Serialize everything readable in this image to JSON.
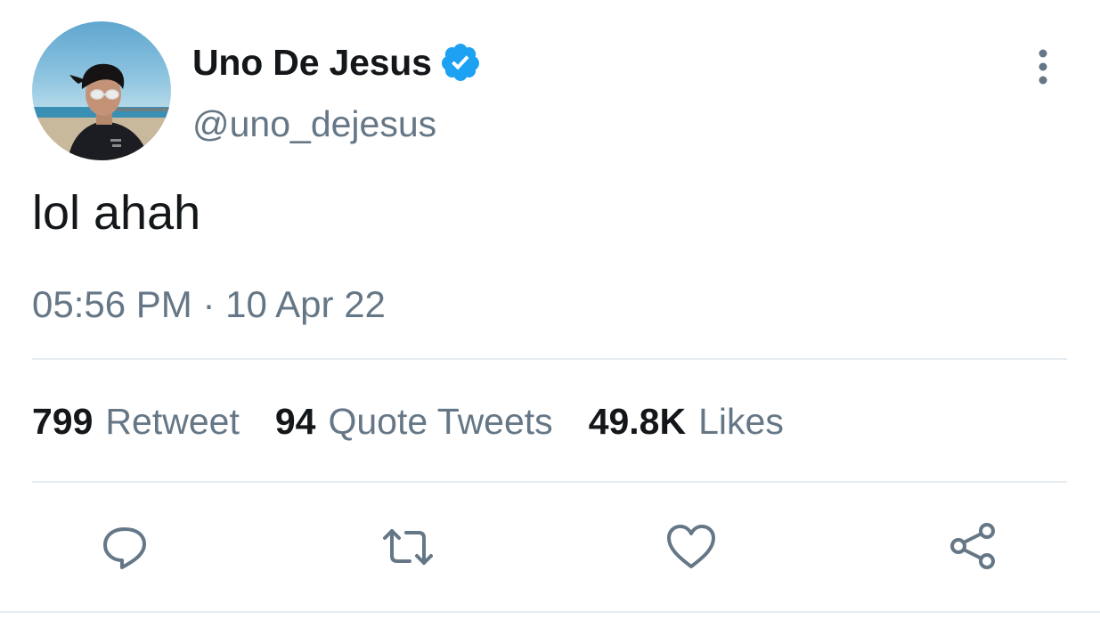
{
  "author": {
    "display_name": "Uno De Jesus",
    "handle": "@uno_dejesus",
    "verified": true
  },
  "tweet": {
    "text": "lol ahah",
    "timestamp": "05:56 PM · 10 Apr 22"
  },
  "stats": [
    {
      "count": "799",
      "label": "Retweet"
    },
    {
      "count": "94",
      "label": "Quote Tweets"
    },
    {
      "count": "49.8K",
      "label": "Likes"
    }
  ],
  "actions": [
    "reply-icon",
    "retweet-icon",
    "like-icon",
    "share-icon"
  ],
  "colors": {
    "text": "#14171a",
    "muted": "#657786",
    "verified": "#1da1f2",
    "divider": "#e6ecf0"
  }
}
